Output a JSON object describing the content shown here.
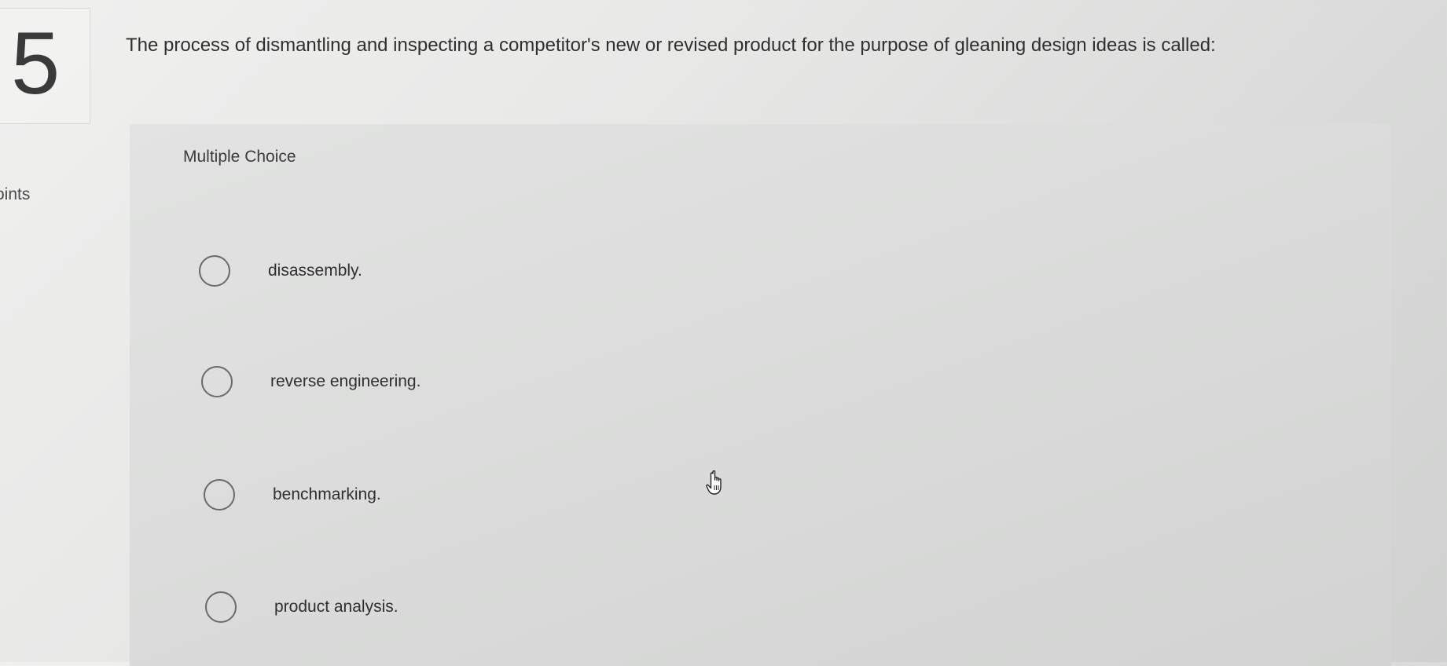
{
  "question": {
    "number": "5",
    "points_label": "oints",
    "text": "The process of dismantling and inspecting a competitor's new or revised product for the purpose of gleaning design ideas is called:"
  },
  "choices_section": {
    "label": "Multiple Choice",
    "options": [
      {
        "label": "disassembly.",
        "selected": false
      },
      {
        "label": "reverse engineering.",
        "selected": false
      },
      {
        "label": "benchmarking.",
        "selected": false
      },
      {
        "label": "product analysis.",
        "selected": false
      }
    ]
  },
  "cursor": {
    "icon": "hand-pointer-icon"
  }
}
